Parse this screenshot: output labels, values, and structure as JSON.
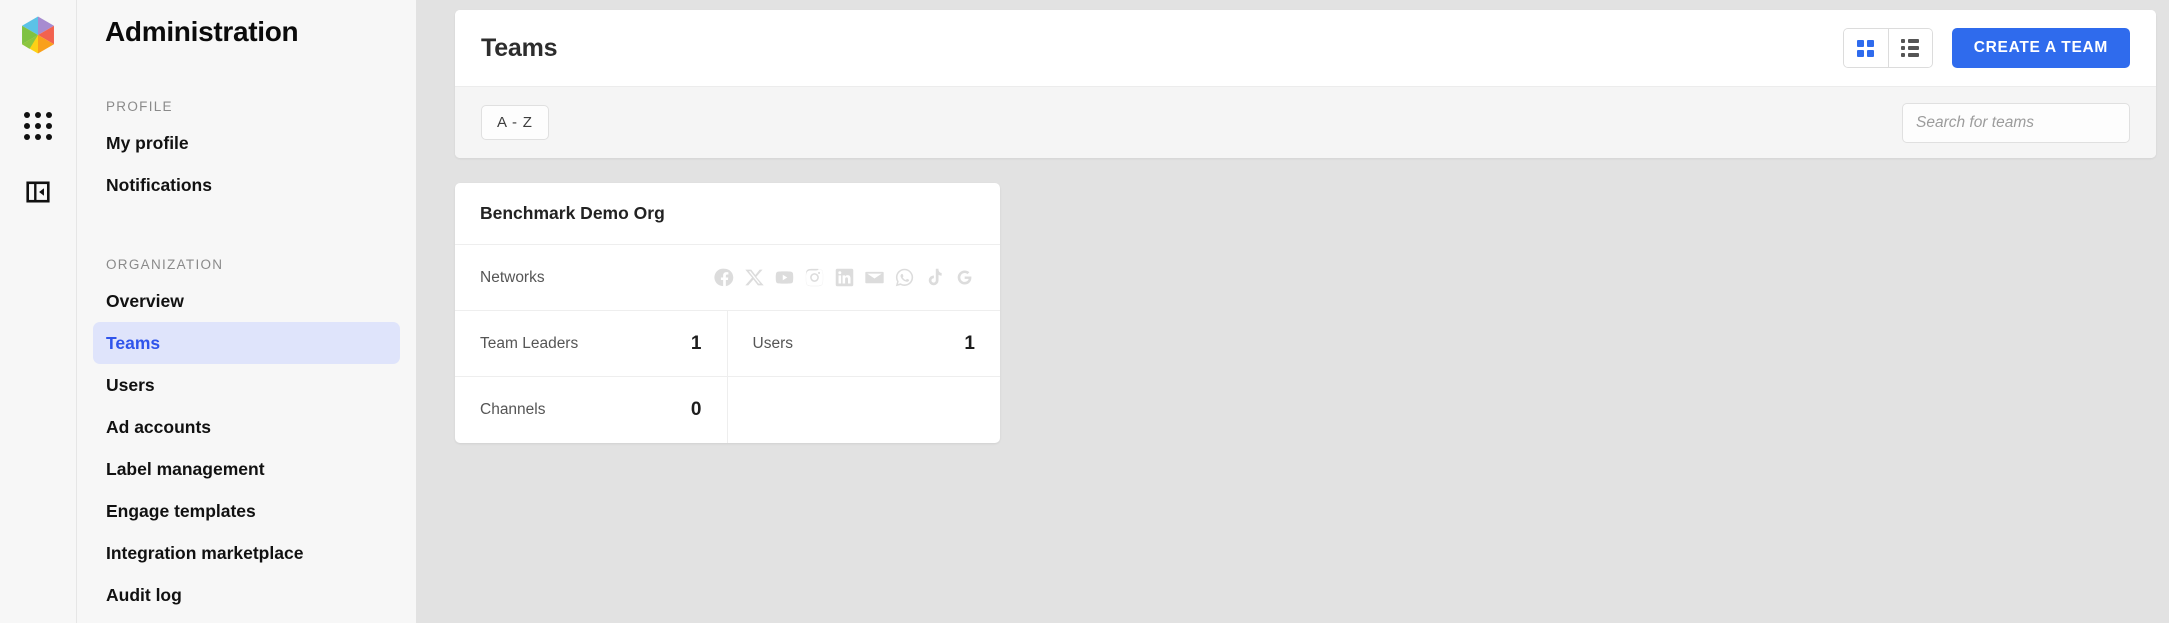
{
  "brand": {
    "logo_icon": "hexagon-logo",
    "accent_color": "#2f6bed",
    "active_nav_bg": "#dfe4fb"
  },
  "rail": {
    "items": [
      {
        "icon": "apps-grid-icon",
        "name": "apps-grid"
      },
      {
        "icon": "collapse-panel-icon",
        "name": "collapse-panel"
      }
    ]
  },
  "sidebar": {
    "title": "Administration",
    "groups": [
      {
        "label": "PROFILE",
        "items": [
          {
            "label": "My profile",
            "active": false
          },
          {
            "label": "Notifications",
            "active": false
          }
        ]
      },
      {
        "label": "ORGANIZATION",
        "items": [
          {
            "label": "Overview",
            "active": false
          },
          {
            "label": "Teams",
            "active": true
          },
          {
            "label": "Users",
            "active": false
          },
          {
            "label": "Ad accounts",
            "active": false
          },
          {
            "label": "Label management",
            "active": false
          },
          {
            "label": "Engage templates",
            "active": false
          },
          {
            "label": "Integration marketplace",
            "active": false
          },
          {
            "label": "Audit log",
            "active": false
          }
        ]
      }
    ]
  },
  "panel": {
    "title": "Teams",
    "view_toggle": {
      "grid_icon": "grid-view-icon",
      "list_icon": "list-view-icon",
      "active": "grid"
    },
    "create_button_label": "CREATE A TEAM",
    "sort_chip_label": "A - Z",
    "search": {
      "placeholder": "Search for teams",
      "value": ""
    }
  },
  "teams": [
    {
      "name": "Benchmark Demo Org",
      "networks_label": "Networks",
      "networks": [
        {
          "name": "facebook-icon",
          "enabled": false
        },
        {
          "name": "x-twitter-icon",
          "enabled": false
        },
        {
          "name": "youtube-icon",
          "enabled": false
        },
        {
          "name": "instagram-icon",
          "enabled": false
        },
        {
          "name": "linkedin-icon",
          "enabled": false
        },
        {
          "name": "email-icon",
          "enabled": false
        },
        {
          "name": "whatsapp-icon",
          "enabled": false
        },
        {
          "name": "tiktok-icon",
          "enabled": false
        },
        {
          "name": "google-icon",
          "enabled": false
        }
      ],
      "stats": [
        {
          "label": "Team Leaders",
          "value": "1"
        },
        {
          "label": "Users",
          "value": "1"
        },
        {
          "label": "Channels",
          "value": "0"
        }
      ]
    }
  ]
}
